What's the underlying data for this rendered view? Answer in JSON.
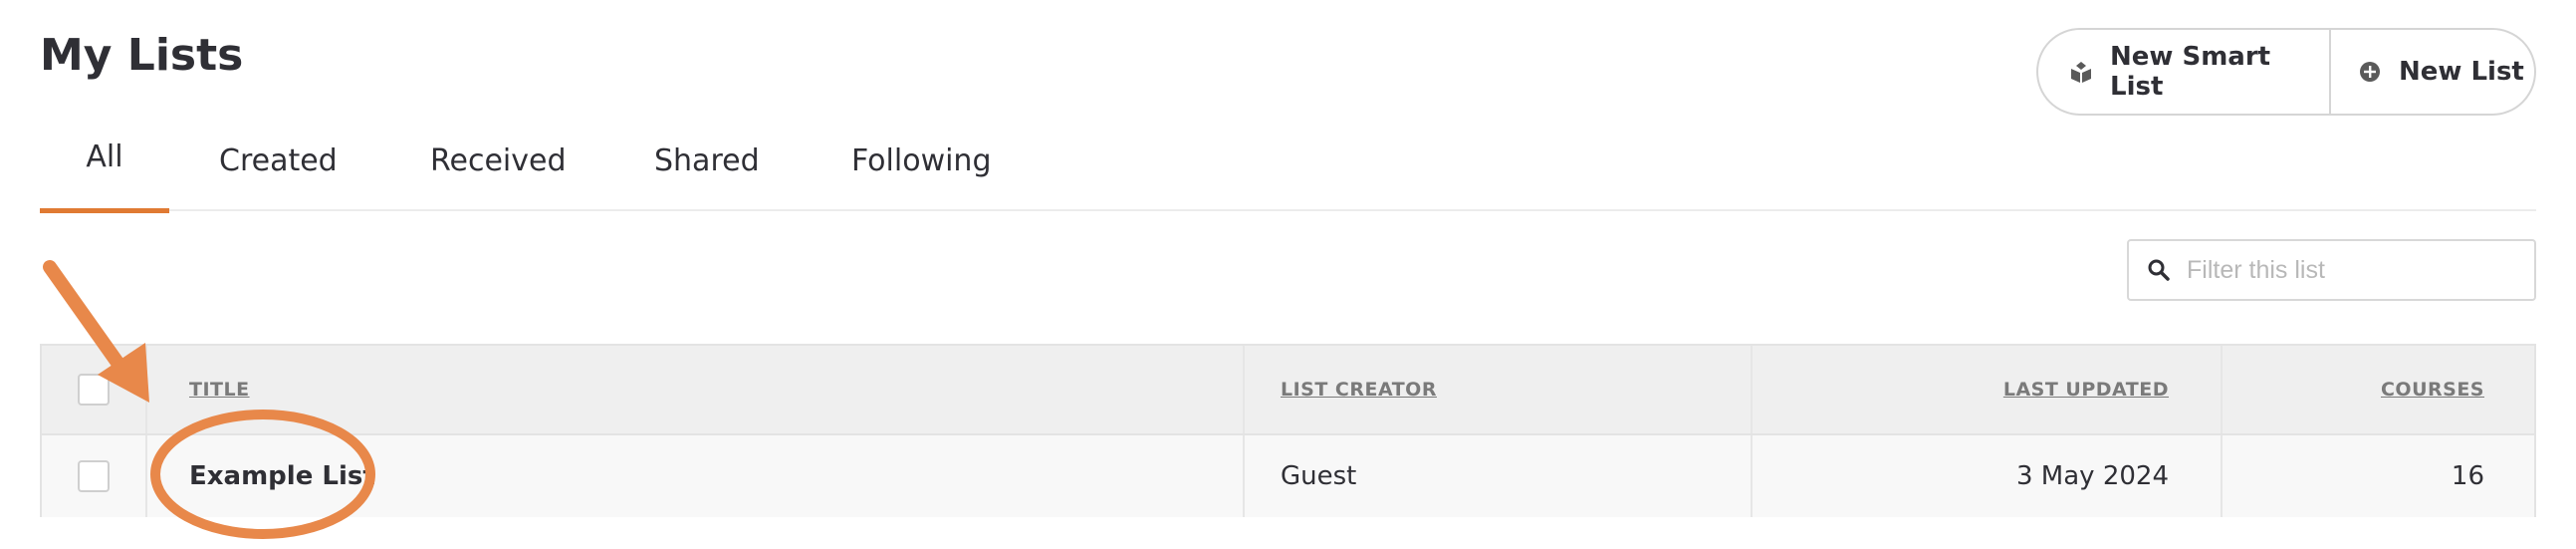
{
  "page": {
    "title": "My Lists"
  },
  "actions": {
    "new_smart_list": "New Smart List",
    "new_list": "New List"
  },
  "tabs": [
    {
      "label": "All",
      "active": true
    },
    {
      "label": "Created",
      "active": false
    },
    {
      "label": "Received",
      "active": false
    },
    {
      "label": "Shared",
      "active": false
    },
    {
      "label": "Following",
      "active": false
    }
  ],
  "filter": {
    "placeholder": "Filter this list",
    "value": ""
  },
  "table": {
    "columns": [
      "TITLE",
      "LIST CREATOR",
      "LAST UPDATED",
      "COURSES"
    ],
    "rows": [
      {
        "title": "Example List",
        "creator": "Guest",
        "last_updated": "3 May 2024",
        "courses": "16"
      }
    ]
  },
  "colors": {
    "accent": "#e07a33",
    "annotation": "#e8884a"
  },
  "icons": {
    "smart_list": "smart-list-icon",
    "new_list": "plus-circle-icon",
    "filter": "search-icon"
  }
}
